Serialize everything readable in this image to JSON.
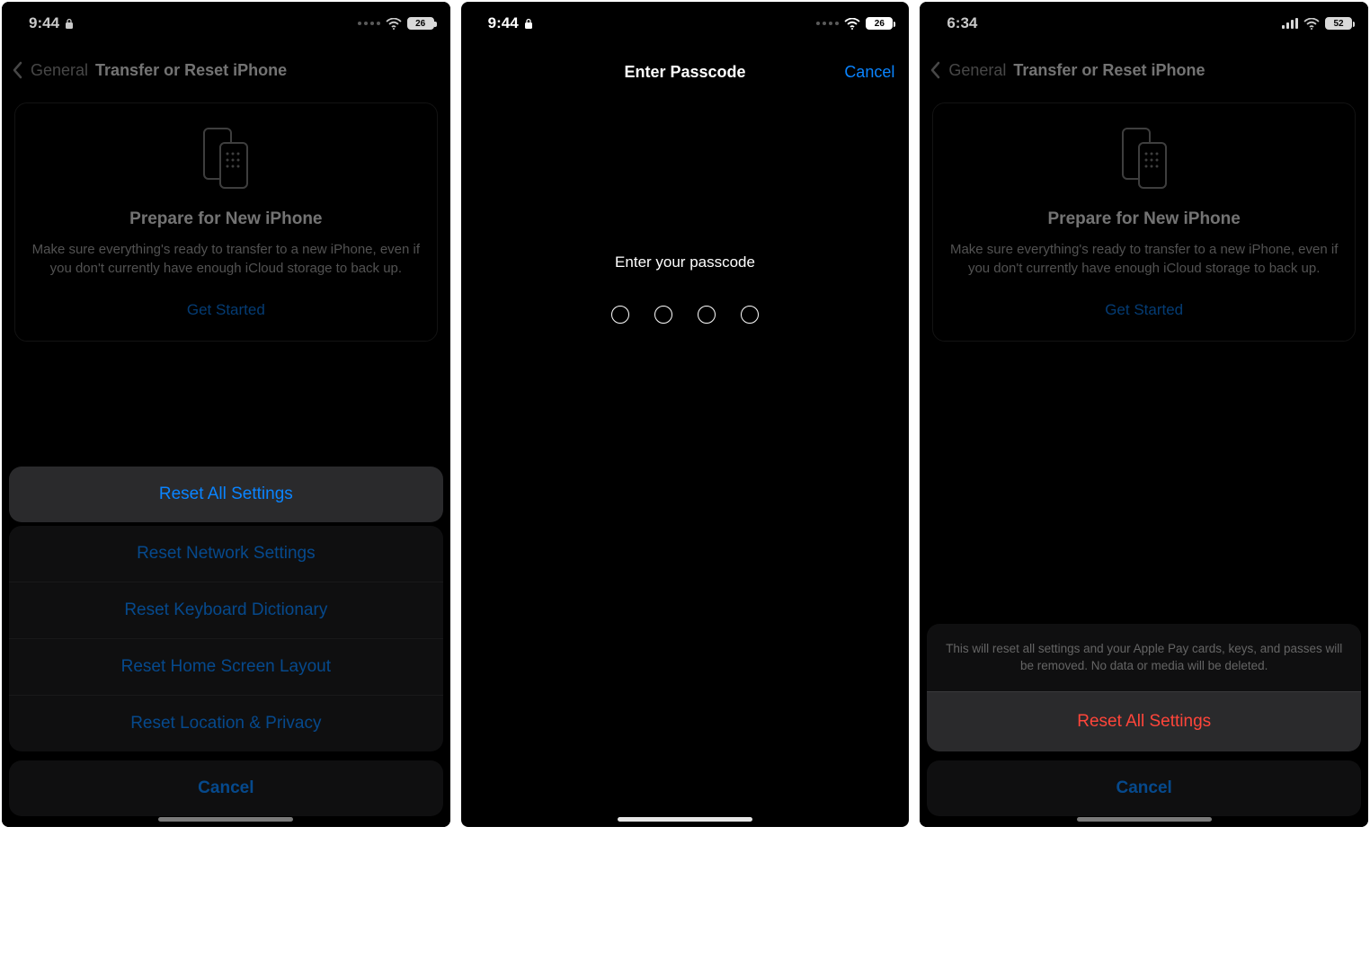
{
  "screens": {
    "s1": {
      "time": "9:44",
      "battery": "26",
      "nav_back": "General",
      "nav_title": "Transfer or Reset iPhone",
      "prepare_title": "Prepare for New iPhone",
      "prepare_desc": "Make sure everything's ready to transfer to a new iPhone, even if you don't currently have enough iCloud storage to back up.",
      "get_started": "Get Started",
      "sheet": {
        "reset_all": "Reset All Settings",
        "reset_network": "Reset Network Settings",
        "reset_keyboard": "Reset Keyboard Dictionary",
        "reset_home": "Reset Home Screen Layout",
        "reset_location": "Reset Location & Privacy",
        "cancel": "Cancel"
      }
    },
    "s2": {
      "time": "9:44",
      "battery": "26",
      "title": "Enter Passcode",
      "cancel": "Cancel",
      "prompt": "Enter your passcode"
    },
    "s3": {
      "time": "6:34",
      "battery": "52",
      "nav_back": "General",
      "nav_title": "Transfer or Reset iPhone",
      "prepare_title": "Prepare for New iPhone",
      "prepare_desc": "Make sure everything's ready to transfer to a new iPhone, even if you don't currently have enough iCloud storage to back up.",
      "get_started": "Get Started",
      "confirm_msg": "This will reset all settings and your Apple Pay cards, keys, and passes will be removed. No data or media will be deleted.",
      "confirm_action": "Reset All Settings",
      "confirm_cancel": "Cancel"
    }
  },
  "colors": {
    "accent": "#0a84ff",
    "destructive": "#ff453a"
  }
}
